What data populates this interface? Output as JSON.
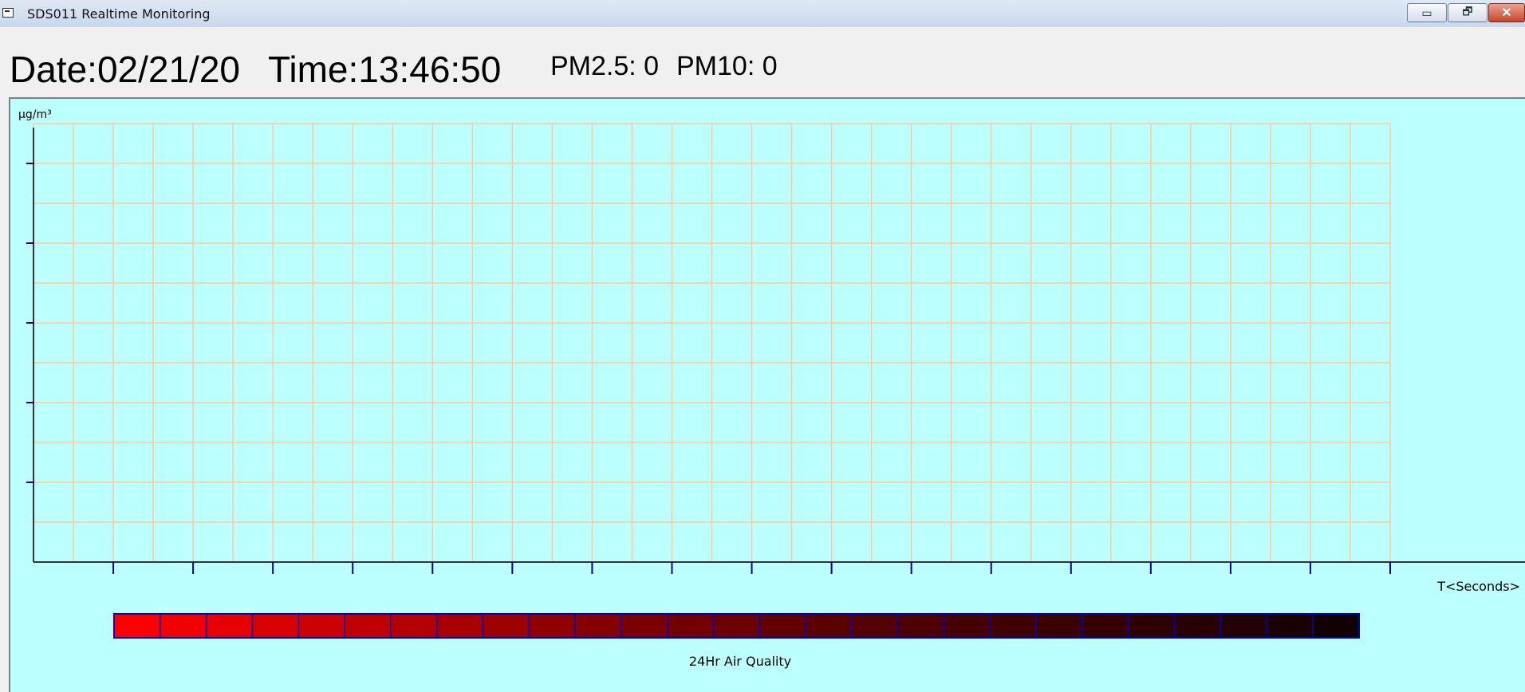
{
  "window": {
    "title": "SDS011 Realtime Monitoring",
    "buttons": {
      "minimize": "▭",
      "restore": "🗗",
      "close": "✕"
    }
  },
  "readout": {
    "date": "Date:02/21/20",
    "time": "Time:13:46:50",
    "pm25": "PM2.5: 0",
    "pm10": "PM10: 0"
  },
  "chart": {
    "y_unit": "µg/m³",
    "x_unit": "T<Seconds>",
    "grid_color": "#ffc896",
    "background": "#bcffff",
    "vertical_grid_count": 35,
    "horizontal_grid_count": 11
  },
  "chart_data": {
    "type": "line",
    "title": "",
    "xlabel": "T<Seconds>",
    "ylabel": "µg/m³",
    "grid": true,
    "series": []
  },
  "air_quality_bar": {
    "label": "24Hr Air Quality",
    "colors": [
      "#ff0000",
      "#f20000",
      "#e60000",
      "#d90000",
      "#cc0000",
      "#c00000",
      "#b40000",
      "#a80000",
      "#9c0000",
      "#900000",
      "#850000",
      "#7b0000",
      "#720000",
      "#6a0000",
      "#620000",
      "#5b0000",
      "#540000",
      "#4d0000",
      "#460000",
      "#400000",
      "#3a0000",
      "#340000",
      "#2e0000",
      "#280000",
      "#220000",
      "#1b0000",
      "#120000"
    ]
  }
}
